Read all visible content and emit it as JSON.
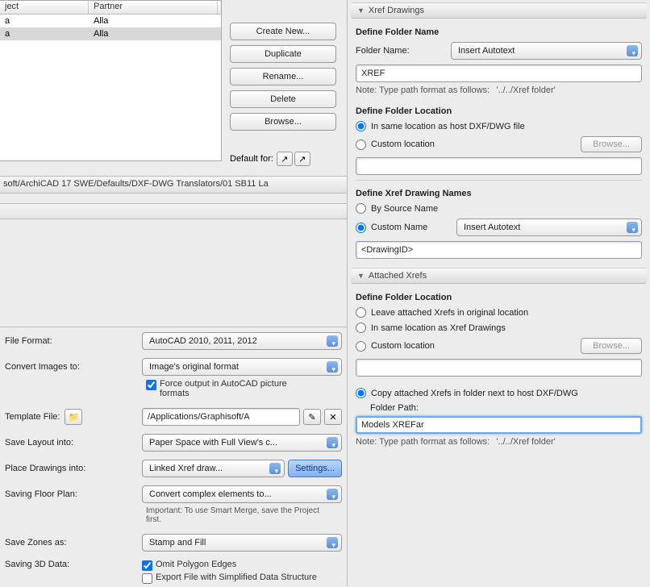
{
  "list": {
    "headers": [
      "ject",
      "Partner"
    ],
    "rows": [
      {
        "c0": "a",
        "c1": "Alla"
      },
      {
        "c0": "a",
        "c1": "Alla"
      }
    ]
  },
  "buttons": {
    "create_new": "Create New...",
    "duplicate": "Duplicate",
    "rename": "Rename...",
    "delete": "Delete",
    "browse": "Browse..."
  },
  "default_for": "Default for:",
  "path_bar": "soft/ArchiCAD 17 SWE/Defaults/DXF-DWG Translators/01 SB11 La",
  "form": {
    "file_format_label": "File Format:",
    "file_format_value": "AutoCAD 2010, 2011, 2012",
    "convert_images_label": "Convert Images to:",
    "convert_images_value": "Image's original format",
    "force_output_label": "Force output in AutoCAD picture formats",
    "template_file_label": "Template File:",
    "template_file_value": "/Applications/Graphisoft/A",
    "save_layout_label": "Save Layout into:",
    "save_layout_value": "Paper Space with Full View's c...",
    "place_drawings_label": "Place Drawings into:",
    "place_drawings_value": "Linked Xref draw...",
    "settings_label": "Settings...",
    "saving_floor_plan_label": "Saving Floor Plan:",
    "saving_floor_plan_value": "Convert complex elements to...",
    "saving_floor_plan_note": "Important: To use Smart Merge, save the Project first.",
    "save_zones_label": "Save Zones as:",
    "save_zones_value": "Stamp and Fill",
    "saving_3d_label": "Saving 3D Data:",
    "omit_polygon": "Omit Polygon Edges",
    "export_simplified": "Export File with Simplified Data Structure"
  },
  "right": {
    "section1_title": "Xref Drawings",
    "define_folder_name": "Define Folder Name",
    "folder_name_label": "Folder Name:",
    "insert_autotext": "Insert Autotext",
    "folder_name_value": "XREF",
    "path_note_prefix": "Note: Type path format as follows:",
    "path_note_example": "'../../Xref folder'",
    "define_folder_location": "Define Folder Location",
    "loc_same_as_host": "In same location as host DXF/DWG file",
    "loc_custom": "Custom location",
    "browse_label": "Browse...",
    "define_xref_names": "Define Xref Drawing Names",
    "by_source_name": "By Source Name",
    "custom_name": "Custom Name",
    "drawing_id_value": "<DrawingID>",
    "section2_title": "Attached Xrefs",
    "leave_attached": "Leave attached Xrefs in original location",
    "same_as_xref_drawings": "In same location as Xref Drawings",
    "copy_attached": "Copy attached Xrefs in folder next to host DXF/DWG",
    "folder_path_label": "Folder Path:",
    "folder_path_value": "Models XREFar"
  }
}
